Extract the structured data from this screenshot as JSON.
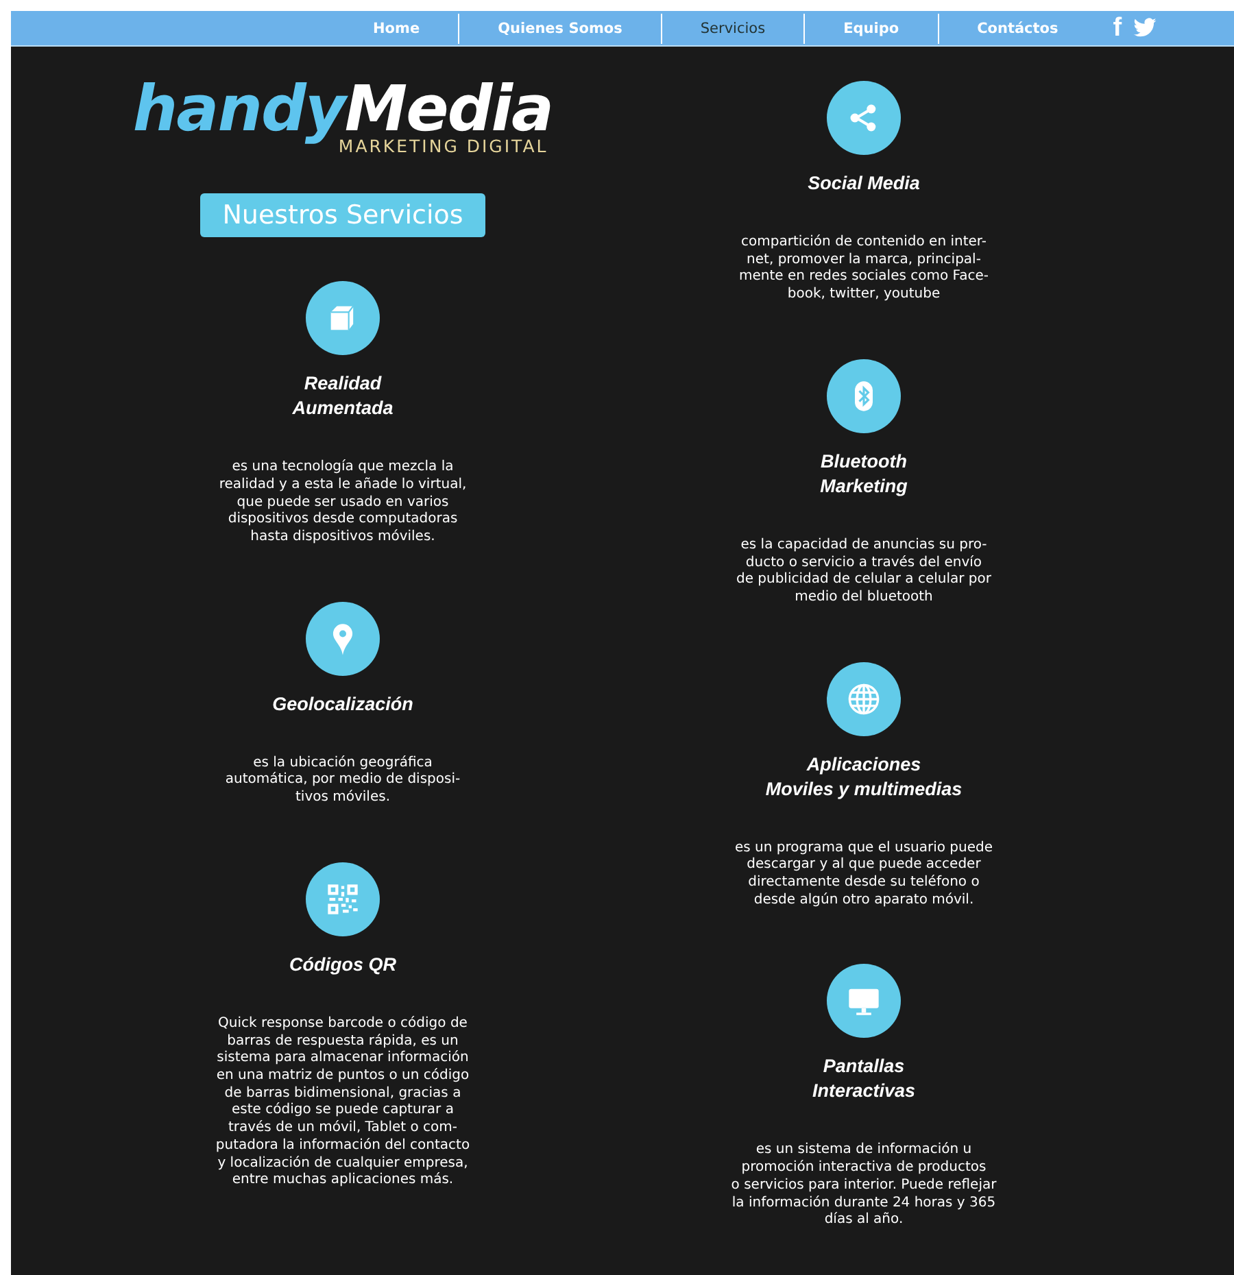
{
  "nav": {
    "items": [
      {
        "label": "Home",
        "selected": false
      },
      {
        "label": "Quienes Somos",
        "selected": false
      },
      {
        "label": "Servicios",
        "selected": true
      },
      {
        "label": "Equipo",
        "selected": false
      },
      {
        "label": "Contáctos",
        "selected": false
      }
    ],
    "social": [
      "f"
    ]
  },
  "left_column": {
    "logo": {
      "part_1": "handy",
      "part_2": "Media",
      "tagline": "MARKETING DIGITAL"
    },
    "heading": "Nuestros Servicios",
    "services": [
      {
        "title_lines": [
          "Realidad",
          "Aumentada"
        ],
        "description_lines": [
          "es una tecnología que mezcla la",
          "realidad y a esta le añade lo virtual,",
          "que puede ser usado en varios",
          "dispositivos desde computadoras",
          "hasta dispositivos móviles."
        ]
      },
      {
        "title_lines": [
          "Geolocalización"
        ],
        "description_lines": [
          "es la ubicación geográfica",
          "automática, por medio de disposi-",
          "tivos móviles."
        ]
      },
      {
        "title_lines": [
          "Códigos QR"
        ],
        "description_lines": [
          "Quick response barcode o código de",
          "barras de respuesta rápida, es un",
          "sistema para almacenar información",
          "en una matriz de puntos o un código",
          "de barras bidimensional, gracias a",
          "este código se puede capturar a",
          "través de un móvil, Tablet o com-",
          "putadora la información del contacto",
          "y localización de cualquier empresa,",
          "entre muchas aplicaciones más."
        ]
      }
    ]
  },
  "right_column": {
    "services": [
      {
        "title_lines": [
          "Social Media"
        ],
        "description_lines": [
          "compartición de contenido en inter-",
          "net, promover la marca, principal-",
          "mente en redes sociales como Face-",
          "book, twitter, youtube"
        ]
      },
      {
        "title_lines": [
          "Bluetooth",
          "Marketing"
        ],
        "description_lines": [
          "es la capacidad de anuncias su pro-",
          "ducto o servicio a través del envío",
          "de publicidad de celular a celular por",
          "medio del bluetooth"
        ]
      },
      {
        "title_lines": [
          "Aplicaciones",
          "Moviles y multimedias"
        ],
        "description_lines": [
          "es un programa que el usuario puede",
          "descargar y al que puede acceder",
          "directamente desde su teléfono o",
          "desde algún otro aparato móvil."
        ]
      },
      {
        "title_lines": [
          "Pantallas",
          "Interactivas"
        ],
        "description_lines": [
          "es un sistema de información u",
          "promoción interactiva de productos",
          "o servicios para interior. Puede reflejar",
          "la información durante 24 horas y 365",
          "días al año."
        ]
      }
    ]
  }
}
